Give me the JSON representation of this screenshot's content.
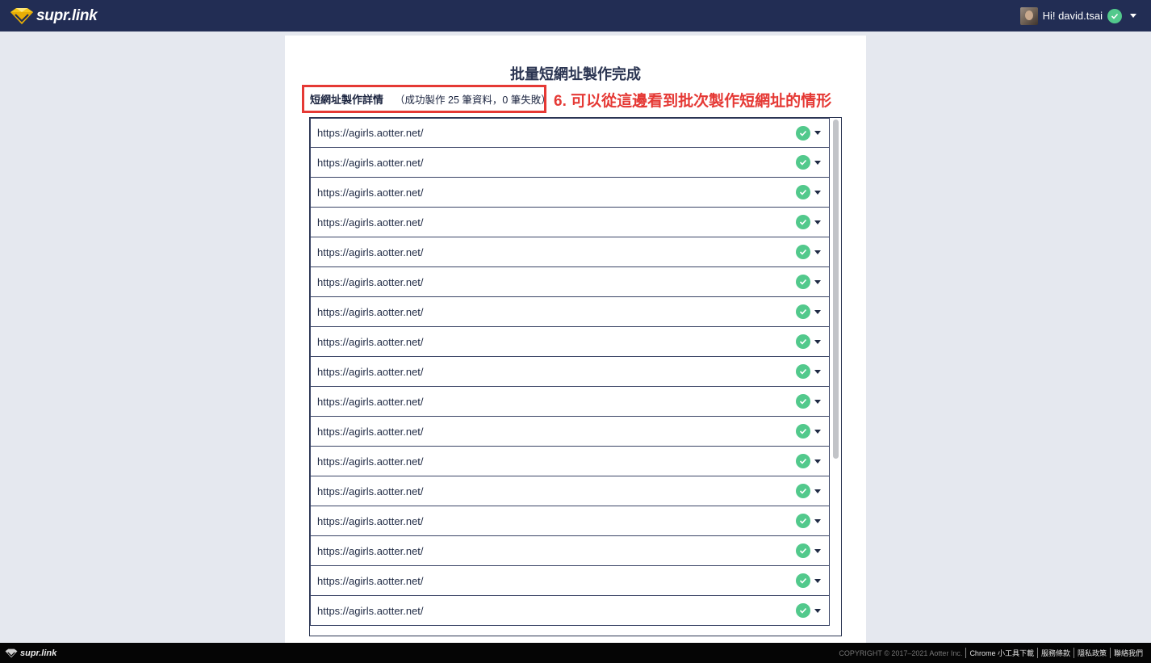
{
  "header": {
    "logo_text": "supr.link",
    "greeting": "Hi! david.tsai"
  },
  "page": {
    "title": "批量短網址製作完成",
    "details_title": "短網址製作詳情",
    "details_summary": "（成功製作 25 筆資料，0 筆失敗）",
    "annotation": "6. 可以從這邊看到批次製作短網址的情形"
  },
  "links": [
    {
      "url": "https://agirls.aotter.net/",
      "status": "success"
    },
    {
      "url": "https://agirls.aotter.net/",
      "status": "success"
    },
    {
      "url": "https://agirls.aotter.net/",
      "status": "success"
    },
    {
      "url": "https://agirls.aotter.net/",
      "status": "success"
    },
    {
      "url": "https://agirls.aotter.net/",
      "status": "success"
    },
    {
      "url": "https://agirls.aotter.net/",
      "status": "success"
    },
    {
      "url": "https://agirls.aotter.net/",
      "status": "success"
    },
    {
      "url": "https://agirls.aotter.net/",
      "status": "success"
    },
    {
      "url": "https://agirls.aotter.net/",
      "status": "success"
    },
    {
      "url": "https://agirls.aotter.net/",
      "status": "success"
    },
    {
      "url": "https://agirls.aotter.net/",
      "status": "success"
    },
    {
      "url": "https://agirls.aotter.net/",
      "status": "success"
    },
    {
      "url": "https://agirls.aotter.net/",
      "status": "success"
    },
    {
      "url": "https://agirls.aotter.net/",
      "status": "success"
    },
    {
      "url": "https://agirls.aotter.net/",
      "status": "success"
    },
    {
      "url": "https://agirls.aotter.net/",
      "status": "success"
    },
    {
      "url": "https://agirls.aotter.net/",
      "status": "success"
    }
  ],
  "footer": {
    "logo_text": "supr.link",
    "copyright": "COPYRIGHT © 2017–2021 Aotter Inc.",
    "links": [
      "Chrome 小工具下載",
      "服務條款",
      "隱私政策",
      "聯絡我們"
    ]
  },
  "colors": {
    "nav_bg": "#222d54",
    "page_bg": "#e5e8ef",
    "success": "#52c98c",
    "annotation": "#e53935",
    "footer_bg": "#050505"
  },
  "icons": {
    "brand": "diamond-logo-icon",
    "status": "check-circle-icon",
    "menu": "caret-down-icon"
  }
}
